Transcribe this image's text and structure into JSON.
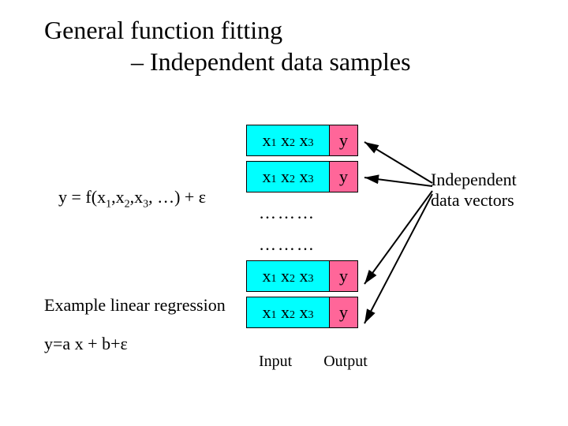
{
  "title": {
    "line1": "General function fitting",
    "line2": "– Independent data samples"
  },
  "formula": {
    "lhs": "y = f",
    "args_open": "(",
    "x1": "x",
    "s1": "1",
    "x2": "x",
    "s2": "2",
    "x3": "x",
    "s3": "3",
    "ell": ", …",
    "args_close": ")",
    "eps": " + ε"
  },
  "example_label": "Example linear regression",
  "eqn2": "y=a x + b+ε",
  "rows": {
    "r1": {
      "x": "x",
      "s1": "1",
      "s2": "2",
      "s3": "3",
      "y": "y"
    },
    "r2": {
      "x": "x",
      "s1": "1",
      "s2": "2",
      "s3": "3",
      "y": "y"
    },
    "dots": "………",
    "r3": {
      "x": "x",
      "s1": "1",
      "s2": "2",
      "s3": "3",
      "y": "y"
    },
    "r4": {
      "x": "x",
      "s1": "1",
      "s2": "2",
      "s3": "3",
      "y": "y"
    }
  },
  "io": {
    "input": "Input",
    "output": "Output"
  },
  "side": {
    "l1": "Independent",
    "l2": "data vectors"
  }
}
